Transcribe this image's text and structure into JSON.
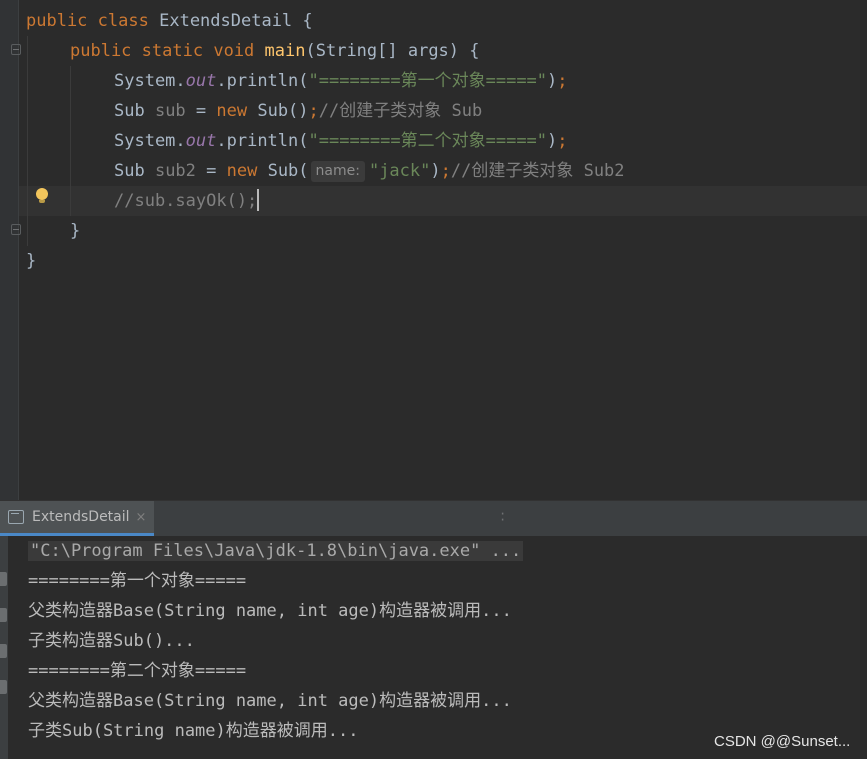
{
  "editor": {
    "class_line": {
      "kw1": "public",
      "kw2": "class",
      "name": "ExtendsDetail",
      "brace": " {"
    },
    "main_line": {
      "kw1": "public",
      "kw2": "static",
      "kw3": "void",
      "method": "main",
      "params": "(String[] args) {"
    },
    "line3": {
      "cls": "System.",
      "field": "out",
      "call": ".println(",
      "str": "\"========第一个对象=====\"",
      "close": ")",
      "semi": ";"
    },
    "line4": {
      "type": "Sub ",
      "var": "sub",
      "eq": " = ",
      "kw": "new",
      "ctor": " Sub()",
      "semi": ";",
      "comment": "//创建子类对象 Sub"
    },
    "line5": {
      "cls": "System.",
      "field": "out",
      "call": ".println(",
      "str": "\"========第二个对象=====\"",
      "close": ")",
      "semi": ";"
    },
    "line6": {
      "type": "Sub ",
      "var": "sub2",
      "eq": " = ",
      "kw": "new",
      "ctor": " Sub(",
      "hint": "name:",
      "str": "\"jack\"",
      "close": ")",
      "semi": ";",
      "comment": "//创建子类对象 Sub2"
    },
    "line7": {
      "comment": "//sub.sayOk();"
    },
    "line8": {
      "brace": "}"
    },
    "line9": {
      "brace": "}"
    }
  },
  "run_panel": {
    "tab_title": "ExtendsDetail",
    "tab_close": "×",
    "console_lines": [
      "\"C:\\Program Files\\Java\\jdk-1.8\\bin\\java.exe\" ...",
      "========第一个对象=====",
      "父类构造器Base(String name, int age)构造器被调用...",
      "子类构造器Sub()...",
      "========第二个对象=====",
      "父类构造器Base(String name, int age)构造器被调用...",
      "子类Sub(String name)构造器被调用..."
    ]
  },
  "watermark": "CSDN @@Sunset...",
  "colors": {
    "background": "#2b2b2b",
    "keyword": "#cc7832",
    "method": "#ffc66d",
    "string": "#6a8759",
    "static_field": "#9876aa",
    "comment": "#808080",
    "text": "#a9b7c6"
  },
  "icons": [
    "fold-minus-icon",
    "lightbulb-icon",
    "run-console-icon",
    "close-icon",
    "drag-handle-icon"
  ]
}
